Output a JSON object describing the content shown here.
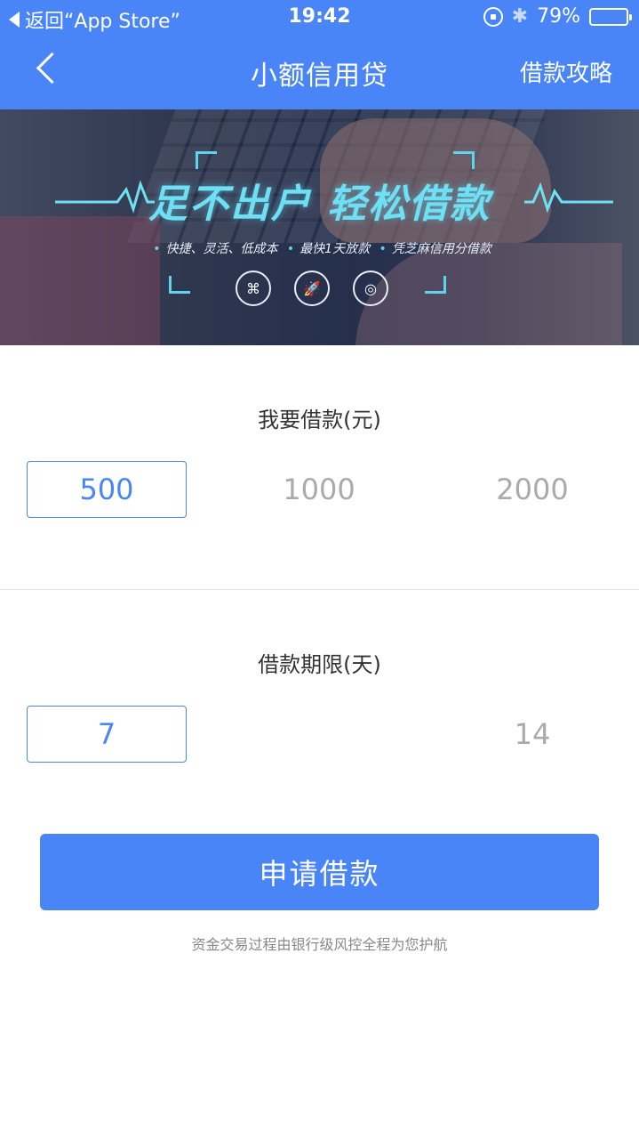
{
  "status_bar": {
    "back_label": "返回“App Store”",
    "time": "19:42",
    "bluetooth": "✱",
    "battery_text": "79%",
    "battery_level": 0.79
  },
  "nav": {
    "title": "小额信用贷",
    "right_link": "借款攻略"
  },
  "banner": {
    "headline": "足不出户 轻松借款",
    "features": [
      "快捷、灵活、低成本",
      "最快1天放款",
      "凭芝麻信用分借款"
    ],
    "icon_names": [
      "computer-icon",
      "rocket-icon",
      "coins-icon"
    ],
    "icon_glyphs": [
      "⌘",
      "🚀",
      "◎"
    ]
  },
  "amount": {
    "title": "我要借款(元)",
    "options": [
      "500",
      "1000",
      "2000"
    ],
    "selected_index": 0
  },
  "term": {
    "title": "借款期限(天)",
    "options": [
      "7",
      "14"
    ],
    "selected_index": 0
  },
  "apply_button": "申请借款",
  "note": "资金交易过程由银行级风控全程为您护航",
  "colors": {
    "primary": "#4a85f7",
    "unselected_text": "#aaaaaa",
    "banner_accent": "#6fe0f3"
  }
}
